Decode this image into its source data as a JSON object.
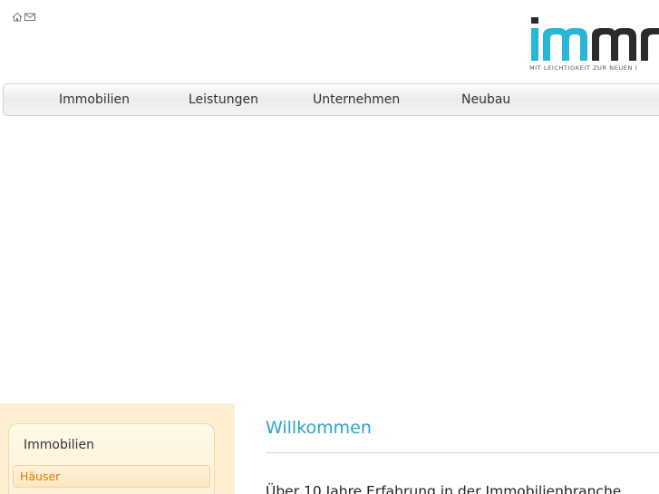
{
  "header": {
    "icons": [
      "home-icon",
      "mail-icon"
    ],
    "logo_text": "imm",
    "tagline": "MIT LEICHTIGKEIT ZUR NEUEN I",
    "brand_colors": {
      "cyan": "#29b6d6",
      "dark": "#2b2b2b"
    }
  },
  "nav": {
    "items": [
      {
        "label": "Immobilien"
      },
      {
        "label": "Leistungen"
      },
      {
        "label": "Unternehmen"
      },
      {
        "label": "Neubau"
      }
    ]
  },
  "sidebar": {
    "title": "Immobilien",
    "items": [
      {
        "label": "Häuser",
        "active": true
      }
    ],
    "accent": "#e87a00"
  },
  "main": {
    "heading": "Willkommen",
    "heading_color": "#2aa3c9",
    "intro": "Über 10 Jahre Erfahrung in der Immobilienbranche"
  }
}
